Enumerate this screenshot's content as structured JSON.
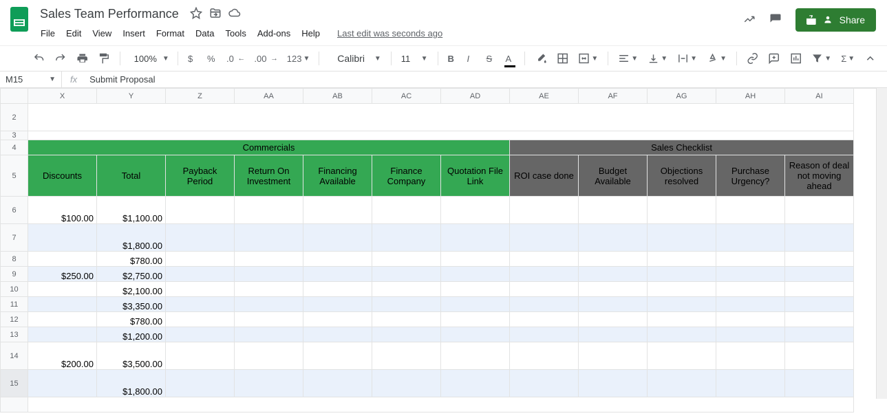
{
  "doc": {
    "title": "Sales Team Performance",
    "last_edit": "Last edit was seconds ago"
  },
  "menu": {
    "file": "File",
    "edit": "Edit",
    "view": "View",
    "insert": "Insert",
    "format": "Format",
    "data": "Data",
    "tools": "Tools",
    "addons": "Add-ons",
    "help": "Help"
  },
  "share": "Share",
  "toolbar": {
    "zoom": "100%",
    "font": "Calibri",
    "font_size": "11",
    "more_fmt": "123"
  },
  "name_box": "M15",
  "formula": "Submit Proposal",
  "columns": [
    "X",
    "Y",
    "Z",
    "AA",
    "AB",
    "AC",
    "AD",
    "AE",
    "AF",
    "AG",
    "AH",
    "AI"
  ],
  "section_headers": {
    "commercials": "Commercials",
    "checklist": "Sales Checklist"
  },
  "sub_headers": {
    "x": "Discounts",
    "y": "Total",
    "z": "Payback Period",
    "aa": "Return On Investment",
    "ab": "Financing Available",
    "ac": "Finance Company",
    "ad": "Quotation File Link",
    "ae": "ROI case done",
    "af": "Budget Available",
    "ag": "Objections resolved",
    "ah": "Purchase Urgency?",
    "ai": "Reason of deal not moving ahead"
  },
  "row_labels": [
    "2",
    "3",
    "4",
    "5",
    "6",
    "7",
    "8",
    "9",
    "10",
    "11",
    "12",
    "13",
    "14",
    "15"
  ],
  "rows": [
    {
      "x": "$100.00",
      "y": "$1,100.00"
    },
    {
      "x": "",
      "y": "$1,800.00"
    },
    {
      "x": "",
      "y": "$780.00"
    },
    {
      "x": "$250.00",
      "y": "$2,750.00"
    },
    {
      "x": "",
      "y": "$2,100.00"
    },
    {
      "x": "",
      "y": "$3,350.00"
    },
    {
      "x": "",
      "y": "$780.00"
    },
    {
      "x": "",
      "y": "$1,200.00"
    },
    {
      "x": "$200.00",
      "y": "$3,500.00"
    },
    {
      "x": "",
      "y": "$1,800.00"
    }
  ]
}
